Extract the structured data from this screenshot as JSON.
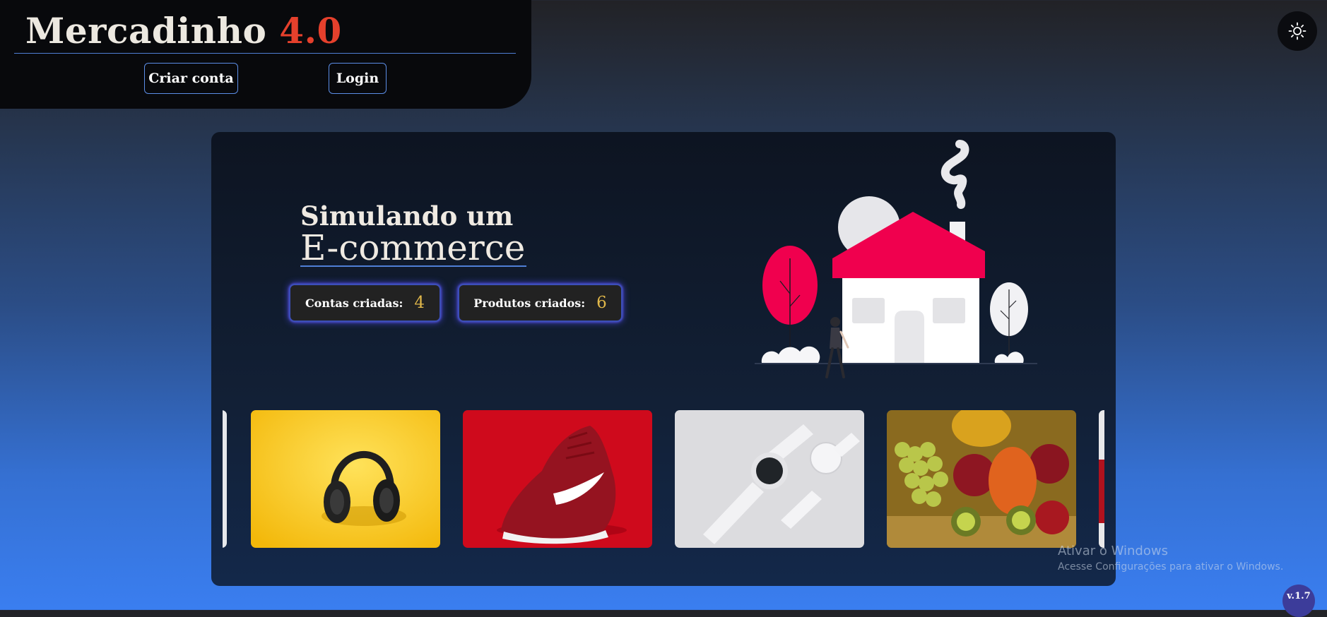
{
  "header": {
    "brand_name": "Mercadinho",
    "brand_version": "4.0",
    "create_account_label": "Criar conta",
    "login_label": "Login",
    "theme_toggle_icon": "sun-icon"
  },
  "hero": {
    "subtitle": "Simulando um",
    "title": "E-commerce",
    "stats": [
      {
        "label": "Contas criadas:",
        "value": "4"
      },
      {
        "label": "Produtos criados:",
        "value": "6"
      }
    ],
    "illustration": "house-illustration"
  },
  "carousel": {
    "slides": [
      {
        "name": "headphones-image"
      },
      {
        "name": "sneaker-image"
      },
      {
        "name": "smartwatch-image"
      },
      {
        "name": "fruits-image"
      }
    ]
  },
  "system": {
    "watermark_title": "Ativar o Windows",
    "watermark_subtitle": "Acesse Configurações para ativar o Windows.",
    "version_badge": "v.1.7"
  },
  "colors": {
    "brand_accent": "#e5402c",
    "stat_value": "#e1b84a",
    "border_accent": "#5b8de6",
    "house_roof": "#f0004e"
  }
}
